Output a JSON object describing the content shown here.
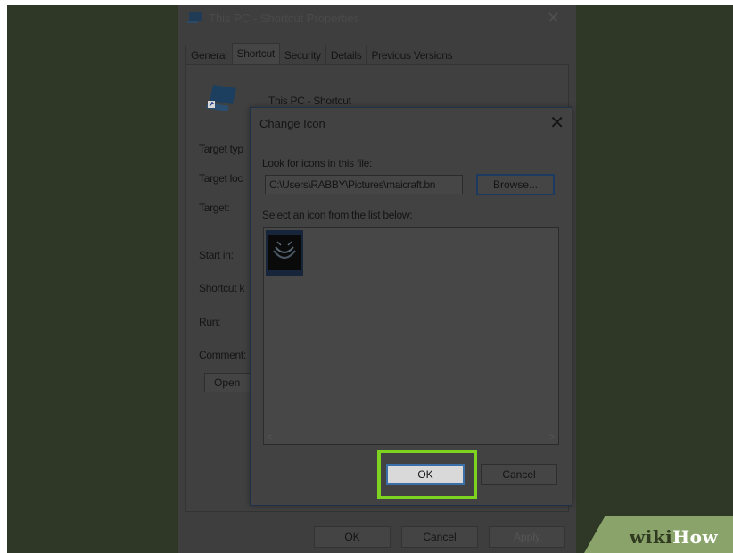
{
  "background_window": {
    "title": "This PC - Shortcut Properties",
    "close_glyph": "✕",
    "tabs": [
      {
        "label": "General",
        "active": false
      },
      {
        "label": "Shortcut",
        "active": true
      },
      {
        "label": "Security",
        "active": false
      },
      {
        "label": "Details",
        "active": false
      },
      {
        "label": "Previous Versions",
        "active": false
      }
    ],
    "shortcut_name": "This PC - Shortcut",
    "field_labels": [
      "Target typ",
      "Target loc",
      "Target:",
      "Start in:",
      "Shortcut k",
      "Run:",
      "Comment:"
    ],
    "open_button": "Open",
    "footer": {
      "ok": "OK",
      "cancel": "Cancel",
      "apply": "Apply"
    }
  },
  "dialog": {
    "title": "Change Icon",
    "close_glyph": "✕",
    "look_for_label": "Look for icons in this file:",
    "path_value": "C:\\Users\\RABBY\\Pictures\\maicraft.bn",
    "browse_button": "Browse...",
    "select_label": "Select an icon from the list below:",
    "scroll_left": "<",
    "scroll_right": ">",
    "ok_button": "OK",
    "cancel_button": "Cancel"
  },
  "watermark": {
    "wiki": "wiki",
    "how": "How"
  },
  "colors": {
    "highlight": "#7ed321",
    "dimmed_bg": "#2f3727",
    "dialog_bg": "#424242"
  },
  "icons": {
    "app_icon": "computer-shortcut-icon",
    "selected_icon": "custom-image-icon"
  }
}
